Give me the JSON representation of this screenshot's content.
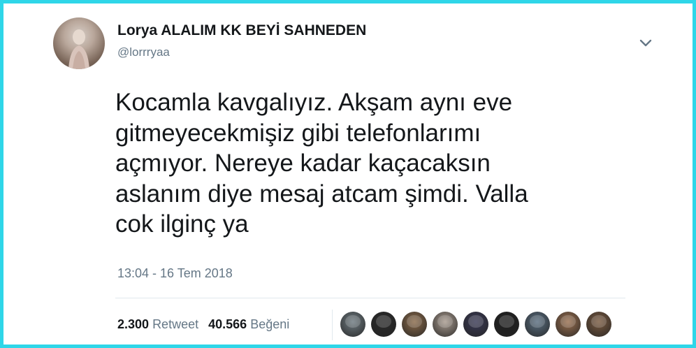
{
  "tweet": {
    "author_name": "Lorya ALALIM KK BEYİ SAHNEDEN",
    "handle": "@lorrryaa",
    "text": "Kocamla kavgalıyız. Akşam aynı eve\ngitmeyecekmişiz gibi telefonlarımı\naçmıyor. Nereye kadar kaçacaksın\naslanım diye mesaj atcam şimdi. Valla\ncok ilginç ya",
    "timestamp": "13:04 - 16 Tem 2018",
    "retweet_count": "2.300",
    "retweet_label": "Retweet",
    "like_count": "40.566",
    "like_label": "Beğeni",
    "menu_icon": "chevron-down-icon"
  },
  "colors": {
    "frame_border": "#2fd6e8",
    "text_primary": "#14171a",
    "text_secondary": "#657786",
    "divider": "#e1e8ed"
  },
  "liker_avatars": [
    {
      "color": "#6e7a80"
    },
    {
      "color": "#2b2b2b"
    },
    {
      "color": "#8a6a4a"
    },
    {
      "color": "#a89a8e"
    },
    {
      "color": "#3a3a55"
    },
    {
      "color": "#1f1f1f"
    },
    {
      "color": "#5a6e80"
    },
    {
      "color": "#9a7050"
    },
    {
      "color": "#7a5a40"
    }
  ]
}
